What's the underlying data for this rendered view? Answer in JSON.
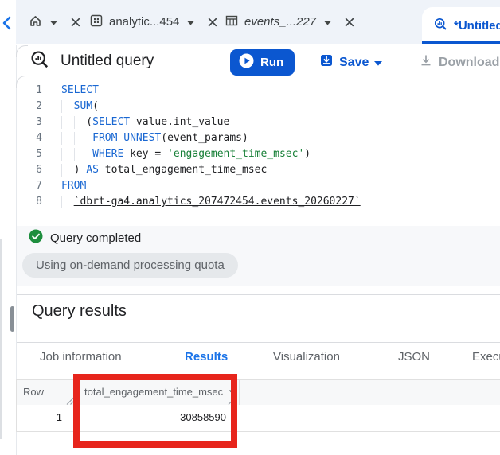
{
  "colors": {
    "accent_blue": "#0b57d0",
    "results_tab_blue": "#1a73e8",
    "keyword_blue": "#1967d2",
    "string_green": "#188038",
    "success_green": "#1e8e3e",
    "annotation_red": "#e7251c",
    "tab_strip_bg": "#eff3f9",
    "chip_bg": "#e5e8eb"
  },
  "tab_strip": {
    "tabs": [
      {
        "icon": "home-icon",
        "label": "",
        "active": false,
        "italic": false
      },
      {
        "icon": "dataset-icon",
        "label": "analytic...454",
        "active": false,
        "italic": false
      },
      {
        "icon": "table-icon",
        "label": "events_...227",
        "active": false,
        "italic": true
      },
      {
        "icon": "query-icon",
        "label": "*Untitled query",
        "active": true,
        "italic": false
      }
    ]
  },
  "toolbar": {
    "query_title": "Untitled query",
    "run_label": "Run",
    "save_label": "Save",
    "download_label": "Download"
  },
  "editor": {
    "lines": [
      {
        "num": "1",
        "guides": [],
        "tokens": [
          {
            "text": "SELECT",
            "type": "kw"
          }
        ]
      },
      {
        "num": "2",
        "guides": [
          0
        ],
        "tokens": [
          {
            "text": "  ",
            "type": "plain"
          },
          {
            "text": "SUM",
            "type": "kw"
          },
          {
            "text": "(",
            "type": "plain"
          }
        ]
      },
      {
        "num": "3",
        "guides": [
          0,
          2
        ],
        "tokens": [
          {
            "text": "    (",
            "type": "plain"
          },
          {
            "text": "SELECT",
            "type": "kw"
          },
          {
            "text": " value.int_value",
            "type": "plain"
          }
        ]
      },
      {
        "num": "4",
        "guides": [
          0,
          2
        ],
        "tokens": [
          {
            "text": "     ",
            "type": "plain"
          },
          {
            "text": "FROM",
            "type": "kw"
          },
          {
            "text": " ",
            "type": "plain"
          },
          {
            "text": "UNNEST",
            "type": "kw"
          },
          {
            "text": "(event_params)",
            "type": "plain"
          }
        ]
      },
      {
        "num": "5",
        "guides": [
          0,
          2
        ],
        "tokens": [
          {
            "text": "     ",
            "type": "plain"
          },
          {
            "text": "WHERE",
            "type": "kw"
          },
          {
            "text": " key = ",
            "type": "plain"
          },
          {
            "text": "'engagement_time_msec'",
            "type": "str"
          },
          {
            "text": ")",
            "type": "plain"
          }
        ]
      },
      {
        "num": "6",
        "guides": [
          0
        ],
        "tokens": [
          {
            "text": "  ) ",
            "type": "plain"
          },
          {
            "text": "AS",
            "type": "kw"
          },
          {
            "text": " total_engagement_time_msec",
            "type": "plain"
          }
        ]
      },
      {
        "num": "7",
        "guides": [],
        "tokens": [
          {
            "text": "FROM",
            "type": "kw"
          }
        ]
      },
      {
        "num": "8",
        "guides": [
          0
        ],
        "tokens": [
          {
            "text": "  ",
            "type": "plain"
          },
          {
            "text": "`dbrt-ga4.analytics_207472454.events_20260227`",
            "type": "link"
          }
        ]
      }
    ]
  },
  "status": {
    "message": "Query completed",
    "quota_chip": "Using on-demand processing quota"
  },
  "results": {
    "heading": "Query results",
    "tabs": [
      {
        "label": "Job information",
        "active": false
      },
      {
        "label": "Results",
        "active": true
      },
      {
        "label": "Visualization",
        "active": false
      },
      {
        "label": "JSON",
        "active": false
      },
      {
        "label": "Execution details",
        "active": false
      }
    ],
    "table": {
      "columns": [
        {
          "name": "Row",
          "sortable": false
        },
        {
          "name": "total_engagement_time_msec",
          "sortable": true
        }
      ],
      "rows": [
        [
          "1",
          "30858590"
        ]
      ]
    }
  }
}
